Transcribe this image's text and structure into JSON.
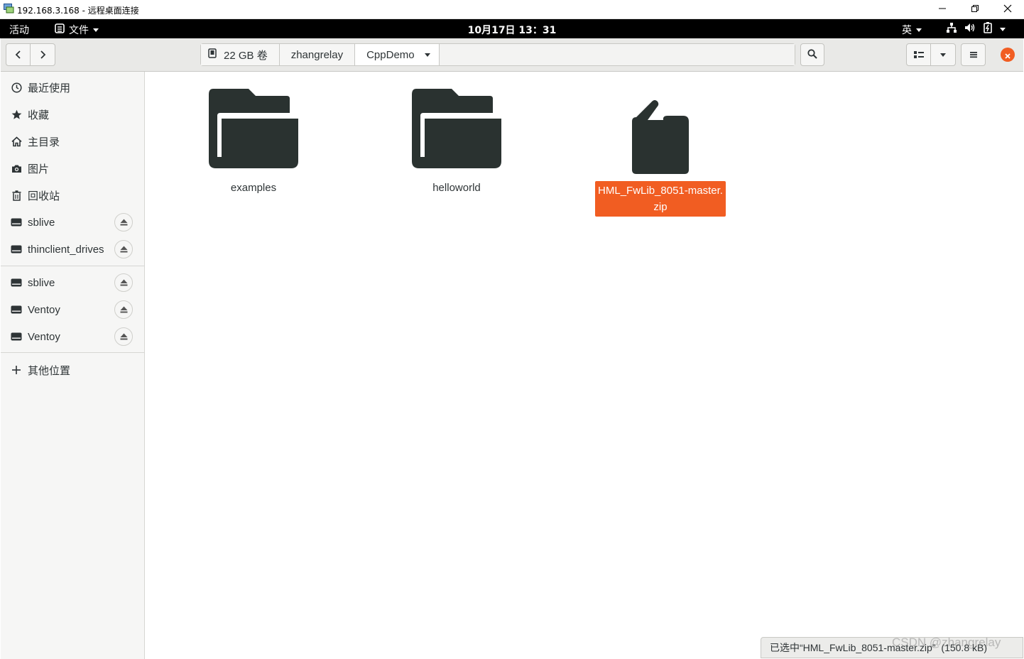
{
  "window": {
    "title": "192.168.3.168 - 远程桌面连接",
    "controls": [
      "minimize",
      "restore",
      "close"
    ]
  },
  "top_bar": {
    "activities": "活动",
    "app_menu": "文件",
    "clock": "10月17日  13：31",
    "input_method": "英"
  },
  "pathbar": {
    "volume": "22 GB 卷",
    "crumbs": [
      "zhangrelay",
      "CppDemo"
    ]
  },
  "sidebar": {
    "places": [
      {
        "label": "最近使用",
        "icon": "clock-icon"
      },
      {
        "label": "收藏",
        "icon": "star-icon"
      },
      {
        "label": "主目录",
        "icon": "home-icon"
      },
      {
        "label": "图片",
        "icon": "camera-icon"
      },
      {
        "label": "回收站",
        "icon": "trash-icon"
      }
    ],
    "mounts": [
      {
        "label": "sblive"
      },
      {
        "label": "thinclient_drives"
      }
    ],
    "devices": [
      {
        "label": "sblive"
      },
      {
        "label": "Ventoy"
      },
      {
        "label": "Ventoy"
      }
    ],
    "other": "其他位置"
  },
  "files": [
    {
      "name": "examples",
      "type": "folder",
      "selected": false
    },
    {
      "name": "helloworld",
      "type": "folder",
      "selected": false
    },
    {
      "name": "HML_FwLib_8051-master.zip",
      "name_line1": "HML_FwLib_8051-master.",
      "name_line2": "zip",
      "type": "archive",
      "selected": true
    }
  ],
  "status": {
    "text": "已选中“HML_FwLib_8051-master.zip”",
    "size": "(150.8 kB)"
  },
  "watermark": "CSDN @zhangrelay",
  "colors": {
    "accent": "#f15d22",
    "icon_dark": "#2a3230",
    "sidebar_bg": "#f6f6f5",
    "headerbar_bg": "#e9e9e7"
  }
}
